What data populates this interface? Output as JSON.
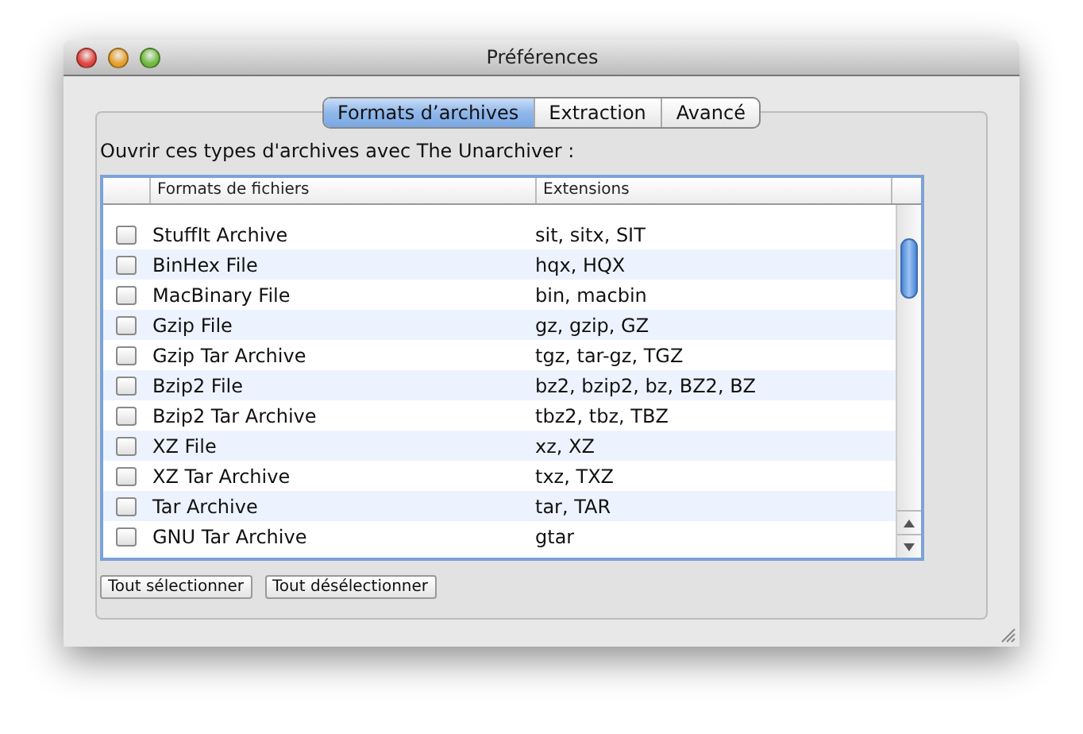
{
  "window": {
    "title": "Préférences"
  },
  "tabs": [
    {
      "label": "Formats d’archives",
      "selected": true
    },
    {
      "label": "Extraction",
      "selected": false
    },
    {
      "label": "Avancé",
      "selected": false
    }
  ],
  "prompt": "Ouvrir ces types d'archives avec The Unarchiver :",
  "table": {
    "columns": [
      "Formats de fichiers",
      "Extensions"
    ],
    "rows": [
      {
        "format": "StuffIt Archive",
        "extensions": "sit, sitx, SIT",
        "checked": false
      },
      {
        "format": "BinHex File",
        "extensions": "hqx, HQX",
        "checked": false
      },
      {
        "format": "MacBinary File",
        "extensions": "bin, macbin",
        "checked": false
      },
      {
        "format": "Gzip File",
        "extensions": "gz, gzip, GZ",
        "checked": false
      },
      {
        "format": "Gzip Tar Archive",
        "extensions": "tgz, tar-gz, TGZ",
        "checked": false
      },
      {
        "format": "Bzip2 File",
        "extensions": "bz2, bzip2, bz, BZ2, BZ",
        "checked": false
      },
      {
        "format": "Bzip2 Tar Archive",
        "extensions": "tbz2, tbz, TBZ",
        "checked": false
      },
      {
        "format": "XZ File",
        "extensions": "xz, XZ",
        "checked": false
      },
      {
        "format": "XZ Tar Archive",
        "extensions": "txz, TXZ",
        "checked": false
      },
      {
        "format": "Tar Archive",
        "extensions": "tar, TAR",
        "checked": false
      },
      {
        "format": "GNU Tar Archive",
        "extensions": "gtar",
        "checked": false
      }
    ]
  },
  "buttons": [
    "Tout sélectionner",
    "Tout désélectionner"
  ]
}
